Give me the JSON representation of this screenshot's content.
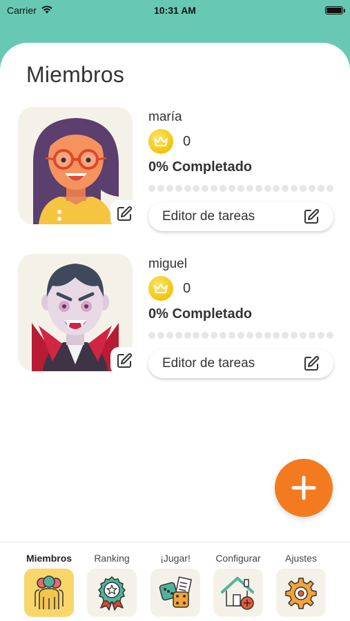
{
  "status_bar": {
    "carrier": "Carrier",
    "time": "10:31 AM"
  },
  "page": {
    "title": "Miembros"
  },
  "members": [
    {
      "name": "maría",
      "coins": "0",
      "completed": "0% Completado",
      "progress": 0,
      "task_editor_label": "Editor de tareas",
      "avatar": "girl-with-glasses-avatar"
    },
    {
      "name": "miguel",
      "coins": "0",
      "completed": "0% Completado",
      "progress": 0,
      "task_editor_label": "Editor de tareas",
      "avatar": "vampire-avatar"
    }
  ],
  "fab": {
    "icon": "plus-icon"
  },
  "tabs": [
    {
      "label": "Miembros",
      "icon": "members-icon",
      "active": true
    },
    {
      "label": "Ranking",
      "icon": "ranking-badge-icon",
      "active": false
    },
    {
      "label": "¡Jugar!",
      "icon": "dice-icon",
      "active": false
    },
    {
      "label": "Configurar",
      "icon": "house-config-icon",
      "active": false
    },
    {
      "label": "Ajustes",
      "icon": "gear-icon",
      "active": false
    }
  ],
  "colors": {
    "header": "#67C9B4",
    "fab": "#F47A1F",
    "active_tab": "#F9D66B",
    "coin": "#F6C817"
  }
}
